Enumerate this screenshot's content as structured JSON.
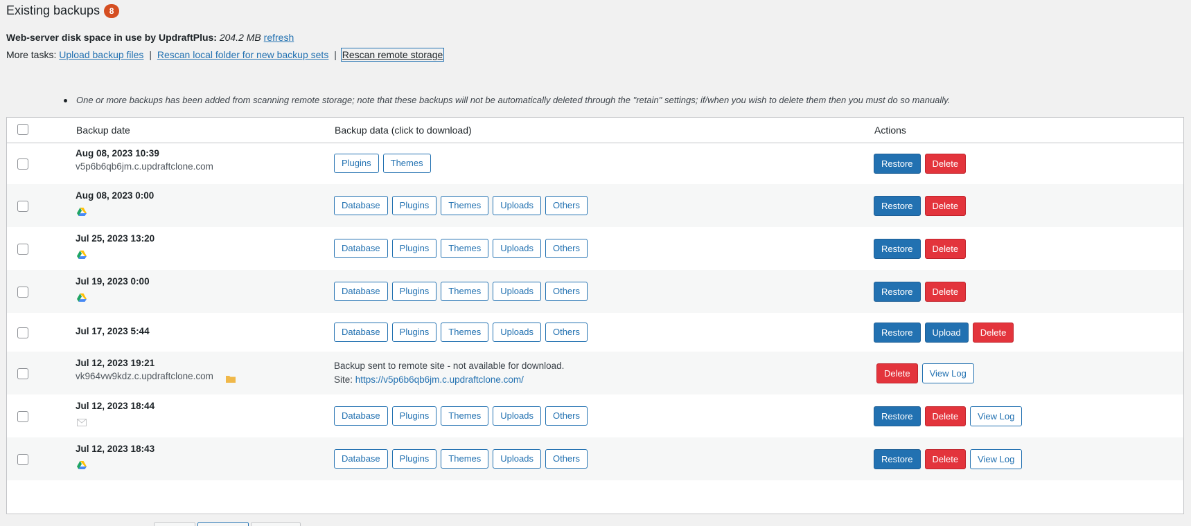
{
  "header": {
    "title": "Existing backups",
    "count": "8"
  },
  "disk": {
    "label": "Web-server disk space in use by UpdraftPlus:",
    "value": "204.2 MB",
    "refresh": "refresh"
  },
  "tasks": {
    "label": "More tasks:",
    "upload": "Upload backup files",
    "rescan_local": "Rescan local folder for new backup sets",
    "rescan_remote": "Rescan remote storage",
    "sep": "|"
  },
  "notice": "One or more backups has been added from scanning remote storage; note that these backups will not be automatically deleted through the \"retain\" settings; if/when you wish to delete them then you must do so manually.",
  "table": {
    "columns": [
      "Backup date",
      "Backup data (click to download)",
      "Actions"
    ],
    "rows": [
      {
        "date": "Aug 08, 2023 10:39",
        "host": "v5p6b6qb6jm.c.updraftclone.com",
        "icon": "",
        "files": [
          "Plugins",
          "Themes"
        ],
        "actions": [
          "Restore",
          "Delete"
        ]
      },
      {
        "date": "Aug 08, 2023 0:00",
        "host": "",
        "icon": "google-drive-icon",
        "files": [
          "Database",
          "Plugins",
          "Themes",
          "Uploads",
          "Others"
        ],
        "actions": [
          "Restore",
          "Delete"
        ]
      },
      {
        "date": "Jul 25, 2023 13:20",
        "host": "",
        "icon": "google-drive-icon",
        "files": [
          "Database",
          "Plugins",
          "Themes",
          "Uploads",
          "Others"
        ],
        "actions": [
          "Restore",
          "Delete"
        ]
      },
      {
        "date": "Jul 19, 2023 0:00",
        "host": "",
        "icon": "google-drive-icon",
        "files": [
          "Database",
          "Plugins",
          "Themes",
          "Uploads",
          "Others"
        ],
        "actions": [
          "Restore",
          "Delete"
        ]
      },
      {
        "date": "Jul 17, 2023 5:44",
        "host": "",
        "icon": "",
        "files": [
          "Database",
          "Plugins",
          "Themes",
          "Uploads",
          "Others"
        ],
        "actions": [
          "Restore",
          "Upload",
          "Delete"
        ]
      },
      {
        "date": "Jul 12, 2023 19:21",
        "host": "vk964vw9kdz.c.updraftclone.com",
        "icon": "folder-icon",
        "files": [],
        "remote_line1": "Backup sent to remote site - not available for download.",
        "remote_site_label": "Site:",
        "remote_site_url": "https://v5p6b6qb6jm.c.updraftclone.com/",
        "actions": [
          "Delete",
          "View Log"
        ]
      },
      {
        "date": "Jul 12, 2023 18:44",
        "host": "",
        "icon": "email-icon",
        "files": [
          "Database",
          "Plugins",
          "Themes",
          "Uploads",
          "Others"
        ],
        "actions": [
          "Restore",
          "Delete",
          "View Log"
        ]
      },
      {
        "date": "Jul 12, 2023 18:43",
        "host": "",
        "icon": "google-drive-icon",
        "files": [
          "Database",
          "Plugins",
          "Themes",
          "Uploads",
          "Others"
        ],
        "actions": [
          "Restore",
          "Delete",
          "View Log"
        ]
      }
    ]
  },
  "colors": {
    "primary": "#2271b1",
    "danger": "#e3343c",
    "badge": "#d54e21"
  }
}
